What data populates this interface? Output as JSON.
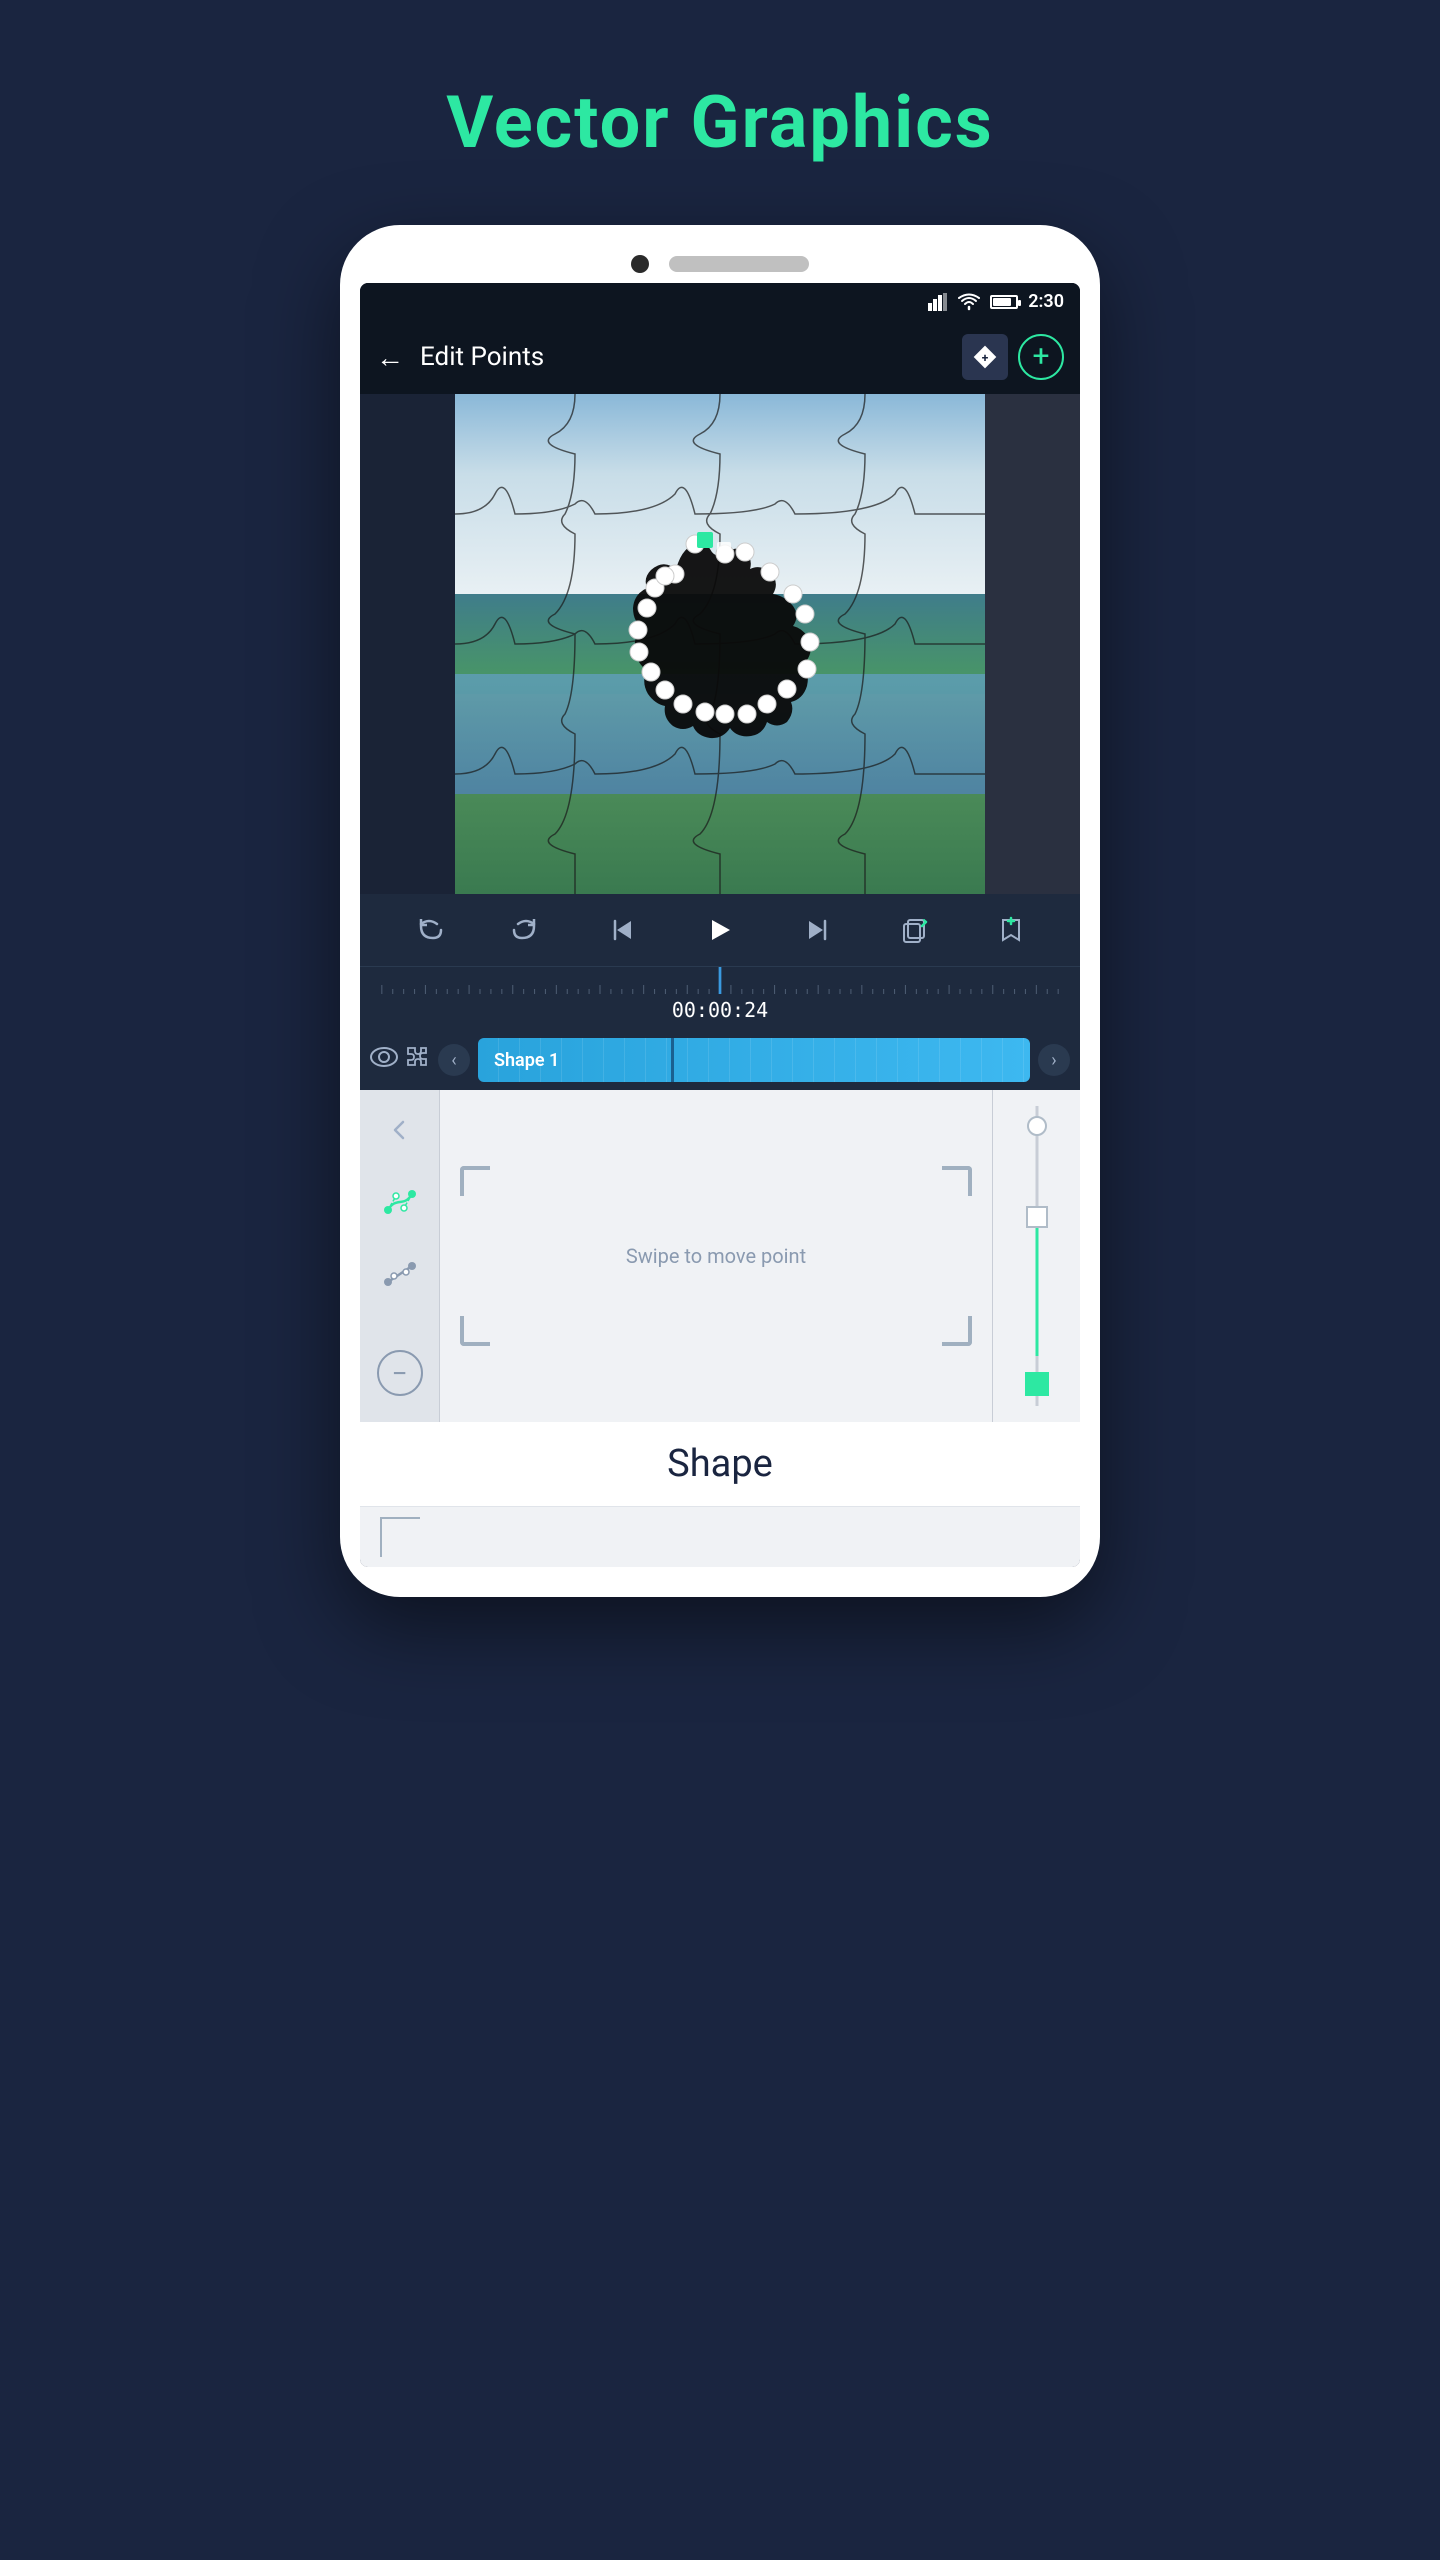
{
  "page": {
    "title": "Vector Graphics",
    "background_color": "#1a2540",
    "title_color": "#2de8a2"
  },
  "status_bar": {
    "time": "2:30",
    "battery_level": 80
  },
  "header": {
    "title": "Edit Points",
    "back_label": "←",
    "diamond_btn_label": "✦+",
    "add_btn_label": "+"
  },
  "playback": {
    "undo_label": "↺",
    "redo_label": "↻",
    "skip_start_label": "⏮",
    "play_label": "▶",
    "skip_end_label": "⏭",
    "copy_label": "⧉",
    "bookmark_label": "🔖"
  },
  "timeline": {
    "time_display": "00:00:24",
    "track_label": "Shape 1"
  },
  "properties": {
    "swipe_hint": "Swipe to move point",
    "shape_label": "Shape",
    "minus_label": "−"
  },
  "sidebar_tools": {
    "back_label": "←",
    "curve_tool_label": "⤡",
    "line_tool_label": "⤢",
    "minus_label": "−"
  }
}
